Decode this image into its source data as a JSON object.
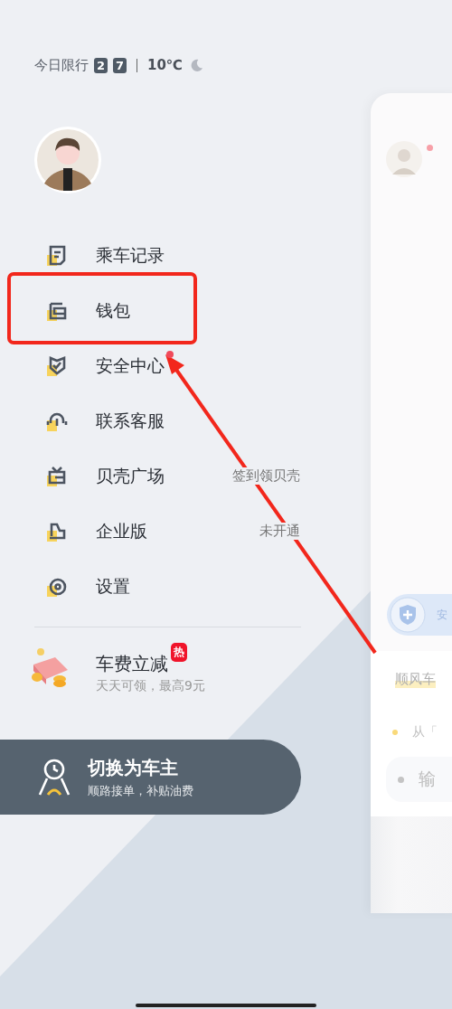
{
  "header": {
    "label": "今日限行",
    "plates": [
      "2",
      "7"
    ],
    "temperature": "10℃"
  },
  "menu": [
    {
      "label": "乘车记录",
      "kind": "record",
      "dot": false
    },
    {
      "label": "钱包",
      "kind": "wallet",
      "dot": false
    },
    {
      "label": "安全中心",
      "kind": "shield",
      "dot": true
    },
    {
      "label": "联系客服",
      "kind": "headset",
      "dot": false
    },
    {
      "label": "贝壳广场",
      "kind": "tv",
      "dot": false,
      "hint": "签到领贝壳"
    },
    {
      "label": "企业版",
      "kind": "building",
      "dot": false,
      "hint": "未开通"
    },
    {
      "label": "设置",
      "kind": "gear",
      "dot": false
    }
  ],
  "promo": {
    "title": "车费立减",
    "tag": "热",
    "subtitle": "天天可领，最高9元"
  },
  "driver_button": {
    "title": "切换为车主",
    "subtitle": "顺路接单，补贴油费"
  },
  "background_panel": {
    "safety_chip": "安",
    "section_title": "顺风车",
    "from_hint": "从「",
    "input_placeholder": "输"
  }
}
